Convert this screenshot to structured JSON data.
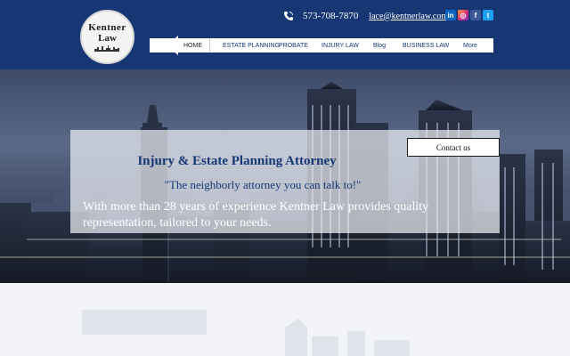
{
  "logo": {
    "line1": "Kentner",
    "line2": "Law"
  },
  "contact": {
    "phone": "573-708-7870",
    "email": "lace@kentnerlaw.com"
  },
  "social": [
    {
      "name": "linkedin-icon",
      "glyph": "in"
    },
    {
      "name": "instagram-icon",
      "glyph": "◎"
    },
    {
      "name": "facebook-icon",
      "glyph": "f"
    },
    {
      "name": "twitter-icon",
      "glyph": "t"
    }
  ],
  "nav": {
    "items": [
      "HOME",
      "ESTATE PLANNING",
      "PROBATE",
      "INJURY LAW",
      "Blog",
      "BUSINESS LAW",
      "More"
    ]
  },
  "hero": {
    "contact_button": "Contact us",
    "headline": "Injury & Estate Planning Attorney",
    "tagline": "\"The neighborly attorney you can talk to!\"",
    "description": "With more than 28 years of experience Kentner Law provides quality representation, tailored to your needs."
  },
  "colors": {
    "header": "#163774",
    "accent_text": "#163774"
  }
}
